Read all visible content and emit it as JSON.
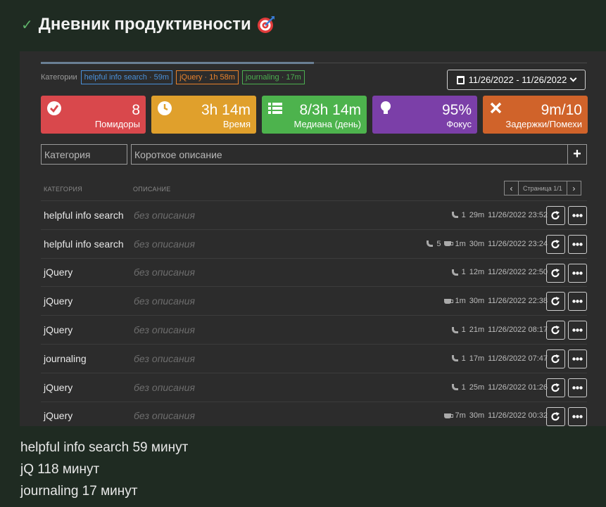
{
  "header": {
    "title": "Дневник продуктивности"
  },
  "categories": {
    "label": "Категории",
    "tags": [
      {
        "text": "helpful info search · 59m",
        "color": "#4a90d9"
      },
      {
        "text": "jQuery · 1h 58m",
        "color": "#e8822c"
      },
      {
        "text": "journaling · 17m",
        "color": "#4caf50"
      }
    ]
  },
  "date_range": "11/26/2022 - 11/26/2022",
  "stats": [
    {
      "value": "8",
      "label": "Помидоры",
      "color": "#d9484c",
      "icon": "check-circle-icon"
    },
    {
      "value": "3h 14m",
      "label": "Время",
      "color": "#e0a02c",
      "icon": "clock-icon"
    },
    {
      "value": "8/3h 14m",
      "label": "Медиана (день)",
      "color": "#4db34d",
      "icon": "list-icon"
    },
    {
      "value": "95%",
      "label": "Фокус",
      "color": "#7b3fa8",
      "icon": "lightbulb-icon"
    },
    {
      "value": "9m/10",
      "label": "Задержки/Помехи",
      "color": "#d0632a",
      "icon": "close-icon"
    }
  ],
  "form": {
    "category_placeholder": "Категория",
    "description_placeholder": "Короткое описание",
    "add_label": "+"
  },
  "table": {
    "col_category": "КАТЕГОРИЯ",
    "col_description": "ОПИСАНИЕ",
    "page_label": "Страница 1/1",
    "rows": [
      {
        "category": "helpful info search",
        "description": "без описания",
        "calls": "1",
        "breaks": "",
        "duration": "29m",
        "datetime": "11/26/2022 23:52"
      },
      {
        "category": "helpful info search",
        "description": "без описания",
        "calls": "5",
        "breaks": "1m",
        "duration": "30m",
        "datetime": "11/26/2022 23:24"
      },
      {
        "category": "jQuery",
        "description": "без описания",
        "calls": "1",
        "breaks": "",
        "duration": "12m",
        "datetime": "11/26/2022 22:50"
      },
      {
        "category": "jQuery",
        "description": "без описания",
        "calls": "",
        "breaks": "1m",
        "duration": "30m",
        "datetime": "11/26/2022 22:38"
      },
      {
        "category": "jQuery",
        "description": "без описания",
        "calls": "1",
        "breaks": "",
        "duration": "21m",
        "datetime": "11/26/2022 08:17"
      },
      {
        "category": "journaling",
        "description": "без описания",
        "calls": "1",
        "breaks": "",
        "duration": "17m",
        "datetime": "11/26/2022 07:47"
      },
      {
        "category": "jQuery",
        "description": "без описания",
        "calls": "1",
        "breaks": "",
        "duration": "25m",
        "datetime": "11/26/2022 01:26"
      },
      {
        "category": "jQuery",
        "description": "без описания",
        "calls": "",
        "breaks": "7m",
        "duration": "30m",
        "datetime": "11/26/2022 00:32"
      }
    ]
  },
  "notes": [
    "helpful info search 59 минут",
    "jQ 118 минут",
    "journaling 17 минут"
  ]
}
